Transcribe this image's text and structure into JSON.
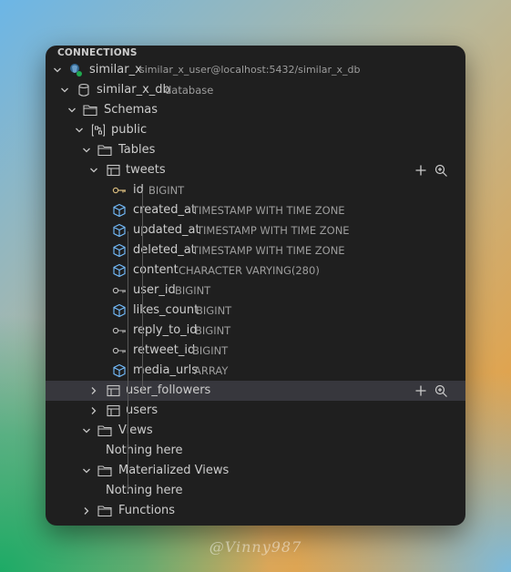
{
  "panel": {
    "title": "CONNECTIONS"
  },
  "connection": {
    "label": "similar_x",
    "detail": "similar_x_user@localhost:5432/similar_x_db"
  },
  "database": {
    "label": "similar_x_db",
    "detail": "database"
  },
  "schemas": {
    "label": "Schemas"
  },
  "schema": {
    "label": "public"
  },
  "tables": {
    "label": "Tables"
  },
  "tweets": {
    "label": "tweets",
    "columns": [
      {
        "name": "id",
        "type": "BIGINT",
        "icon": "key-icon"
      },
      {
        "name": "created_at",
        "type": "TIMESTAMP WITH TIME ZONE",
        "icon": "column-icon"
      },
      {
        "name": "updated_at",
        "type": "TIMESTAMP WITH TIME ZONE",
        "icon": "column-icon"
      },
      {
        "name": "deleted_at",
        "type": "TIMESTAMP WITH TIME ZONE",
        "icon": "column-icon"
      },
      {
        "name": "content",
        "type": "CHARACTER VARYING(280)",
        "icon": "column-icon"
      },
      {
        "name": "user_id",
        "type": "BIGINT",
        "icon": "foreign-key-icon"
      },
      {
        "name": "likes_count",
        "type": "BIGINT",
        "icon": "column-icon"
      },
      {
        "name": "reply_to_id",
        "type": "BIGINT",
        "icon": "foreign-key-icon"
      },
      {
        "name": "retweet_id",
        "type": "BIGINT",
        "icon": "foreign-key-icon"
      },
      {
        "name": "media_urls",
        "type": "ARRAY",
        "icon": "column-icon"
      }
    ]
  },
  "user_followers": {
    "label": "user_followers"
  },
  "users": {
    "label": "users"
  },
  "views": {
    "label": "Views",
    "empty": "Nothing here"
  },
  "materialized_views": {
    "label": "Materialized Views",
    "empty": "Nothing here"
  },
  "functions": {
    "label": "Functions"
  },
  "watermark": "@Vinny987",
  "colors": {
    "panel_bg": "#1f1f1f",
    "selected_row": "#37373d",
    "key_icon": "#d7ba7d",
    "column_icon": "#75beff",
    "muted_text": "#9d9d9d"
  }
}
